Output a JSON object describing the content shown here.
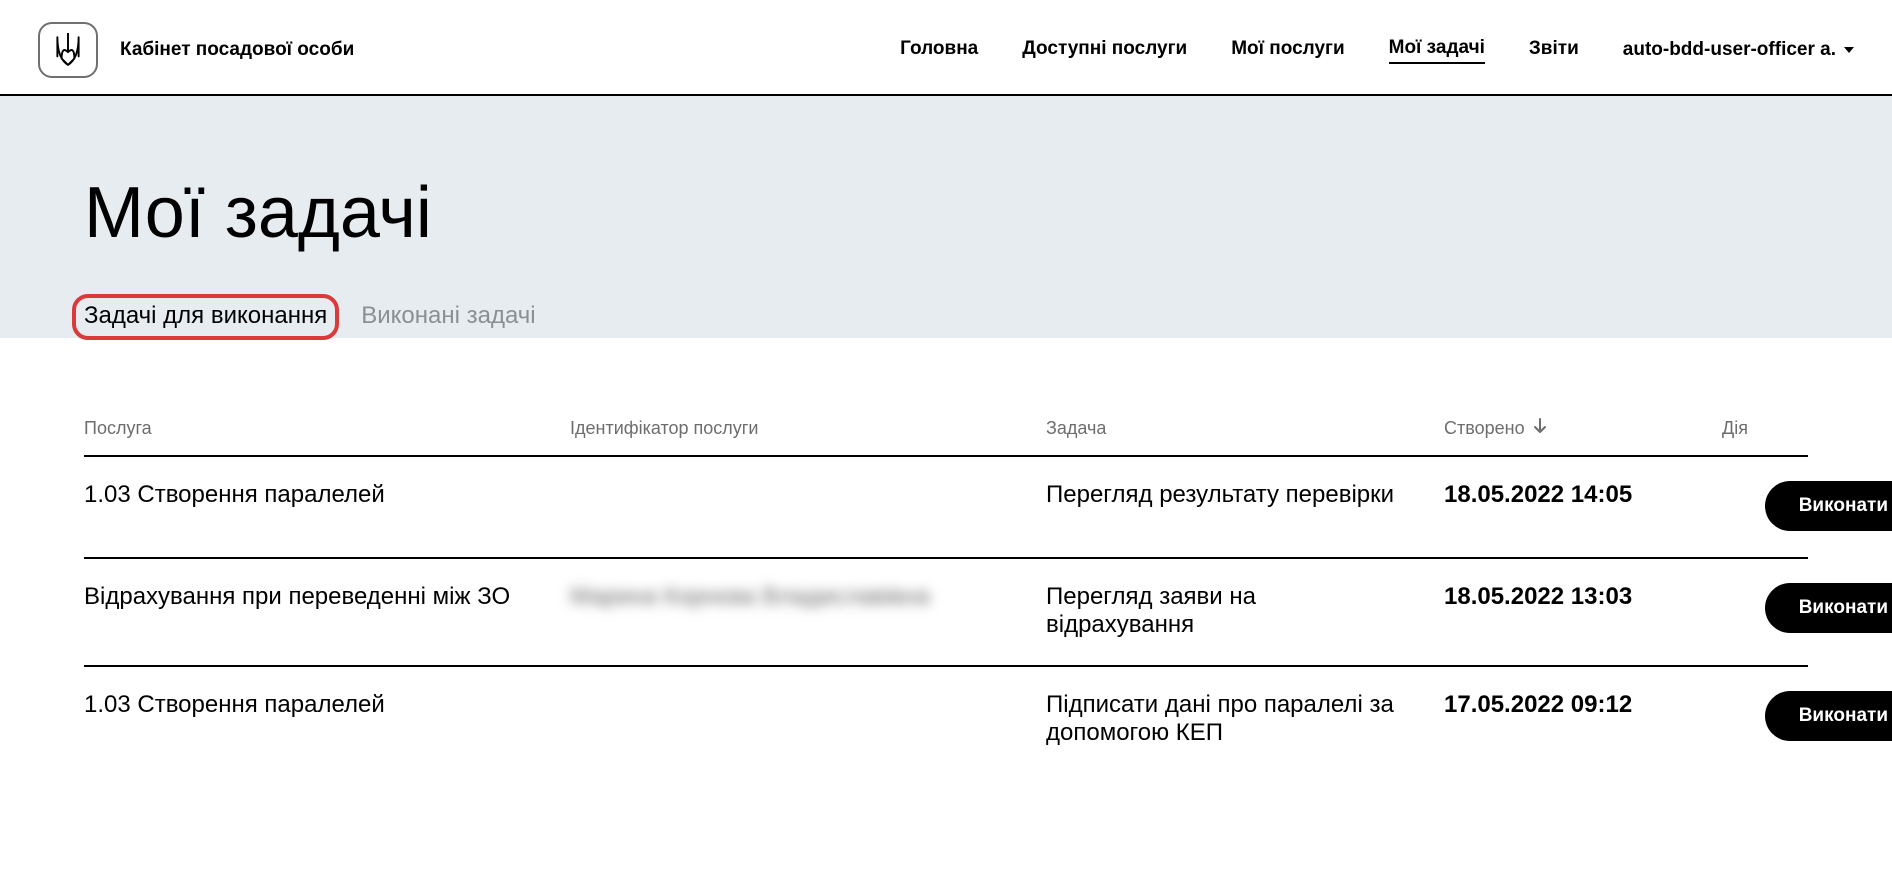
{
  "brand": "Кабінет посадової особи",
  "nav": {
    "home": "Головна",
    "available": "Доступні послуги",
    "my_services": "Мої послуги",
    "my_tasks": "Мої задачі",
    "reports": "Звіти"
  },
  "user": {
    "label": "auto-bdd-user-officer a."
  },
  "page": {
    "title": "Мої задачі"
  },
  "tabs": {
    "todo": "Задачі для виконання",
    "done": "Виконані задачі"
  },
  "table": {
    "head": {
      "service": "Послуга",
      "id": "Ідентифікатор послуги",
      "task": "Задача",
      "created": "Створено",
      "action": "Дія"
    },
    "action_label": "Виконати",
    "rows": [
      {
        "service": "1.03 Створення паралелей",
        "id": "",
        "id_blur": false,
        "task": "Перегляд результату перевірки",
        "created": "18.05.2022 14:05"
      },
      {
        "service": "Відрахування при переведенні між ЗО",
        "id": "Марина Корнєва Владиславівна",
        "id_blur": true,
        "task": "Перегляд заяви на відрахування",
        "created": "18.05.2022 13:03"
      },
      {
        "service": "1.03 Створення паралелей",
        "id": "",
        "id_blur": false,
        "task": "Підписати дані про паралелі за допомогою КЕП",
        "created": "17.05.2022 09:12"
      }
    ]
  }
}
